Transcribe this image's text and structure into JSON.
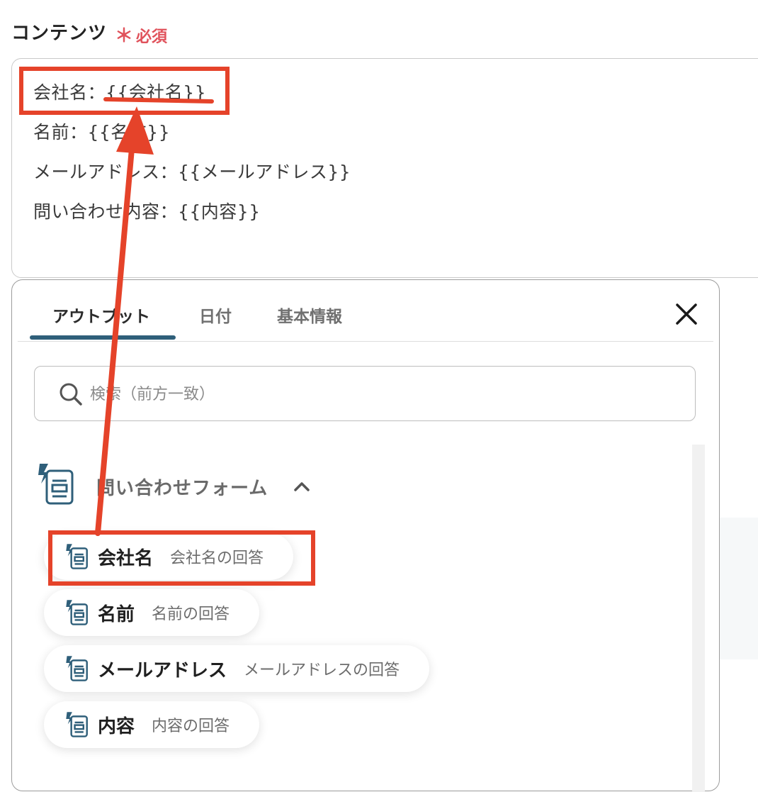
{
  "field": {
    "label": "コンテンツ",
    "required_mark": "＊",
    "required_text": "必須"
  },
  "content": {
    "lines": [
      "会社名：{{会社名}}",
      "名前：{{名前}}",
      "メールアドレス：{{メールアドレス}}",
      "問い合わせ内容：{{内容}}"
    ]
  },
  "panel": {
    "tabs": [
      "アウトプット",
      "日付",
      "基本情報"
    ],
    "active_tab": "アウトプット",
    "search_placeholder": "検索（前方一致）",
    "group": {
      "title": "問い合わせフォーム",
      "icon": "form-icon",
      "expanded": true,
      "items": [
        {
          "name": "会社名",
          "desc": "会社名の回答"
        },
        {
          "name": "名前",
          "desc": "名前の回答"
        },
        {
          "name": "メールアドレス",
          "desc": "メールアドレスの回答"
        },
        {
          "name": "内容",
          "desc": "内容の回答"
        }
      ]
    }
  },
  "annotation": {
    "color": "#e5432a"
  }
}
